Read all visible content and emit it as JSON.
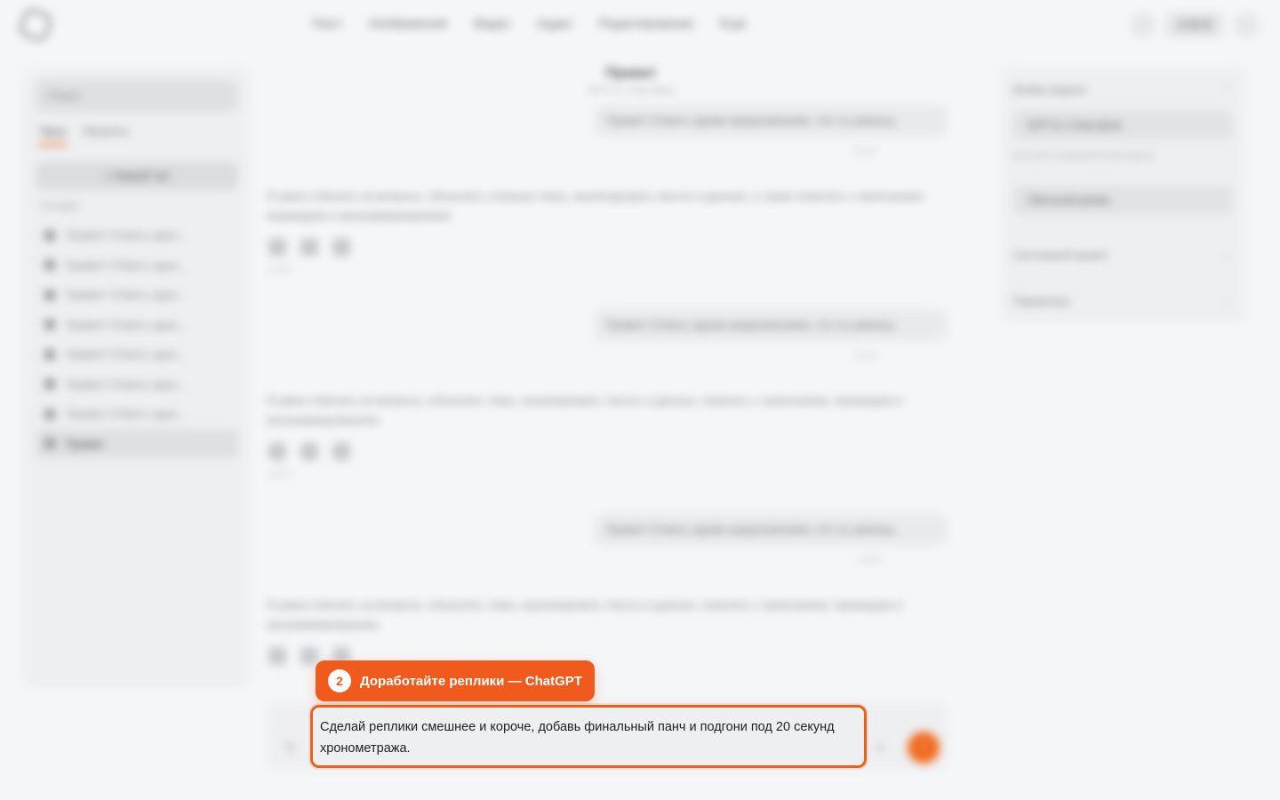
{
  "header": {
    "nav": [
      "Текст",
      "Изображения",
      "Видео",
      "Аудио",
      "Редактирование",
      "Ещё"
    ],
    "balance": "0.00 $"
  },
  "sidebar": {
    "search_placeholder": "Поиск",
    "tabs": [
      "Чаты",
      "Проекты"
    ],
    "new_chat": "+ Новый чат",
    "section_label": "Сегодня",
    "items": [
      {
        "label": "Привет! Ответь одно..."
      },
      {
        "label": "Привет! Ответь одно..."
      },
      {
        "label": "Привет! Ответь одно..."
      },
      {
        "label": "Привет! Ответь одно..."
      },
      {
        "label": "Привет! Ответь одно..."
      },
      {
        "label": "Привет! Ответь одно..."
      },
      {
        "label": "Привет! Ответь одно..."
      },
      {
        "label": "Привет"
      }
    ]
  },
  "chat": {
    "title": "Привет",
    "model": "GPT-5.1 Chat latest",
    "messages": [
      {
        "role": "user",
        "text": "Привет! Ответь одним предложением, что ты умеешь.",
        "time": "12:00"
      },
      {
        "role": "assistant",
        "text": "Я умею отвечать на вопросы, объяснять сложные темы, анализировать тексты и данные, а также помогать с написанием, переводом и программированием.",
        "time": "12:00"
      },
      {
        "role": "user",
        "text": "Привет! Ответь одним предложением, что ты умеешь.",
        "time": "12:01"
      },
      {
        "role": "assistant",
        "text": "Я умею отвечать на вопросы, объяснять темы, анализировать тексты и данные, помогать с написанием, переводом и программированием.",
        "time": "12:01"
      },
      {
        "role": "user",
        "text": "Привет! Ответь одним предложением, что ты умеешь.",
        "time": "12:02"
      },
      {
        "role": "assistant",
        "text": "Я умею отвечать на вопросы, объяснять темы, анализировать тексты и данные, помогать с написанием, переводом и программированием.",
        "time": "12:02"
      }
    ]
  },
  "right_panel": {
    "model_section": "Выбор модели",
    "model_value": "GPT-5.1 Chat latest",
    "model_hint": "Быстрая и универсальная модель",
    "mode_value": "Обычный режим",
    "system_prompt": "Системный промпт",
    "params": "Параметры"
  },
  "tooltip": {
    "step": "2",
    "text": "Доработайте реплики — ChatGPT"
  },
  "composer": {
    "value": "Сделай реплики смешнее и короче, добавь финальный панч и подгони под 20 секунд хронометража."
  },
  "colors": {
    "accent": "#f05a1c",
    "background": "#f5f6f8"
  }
}
